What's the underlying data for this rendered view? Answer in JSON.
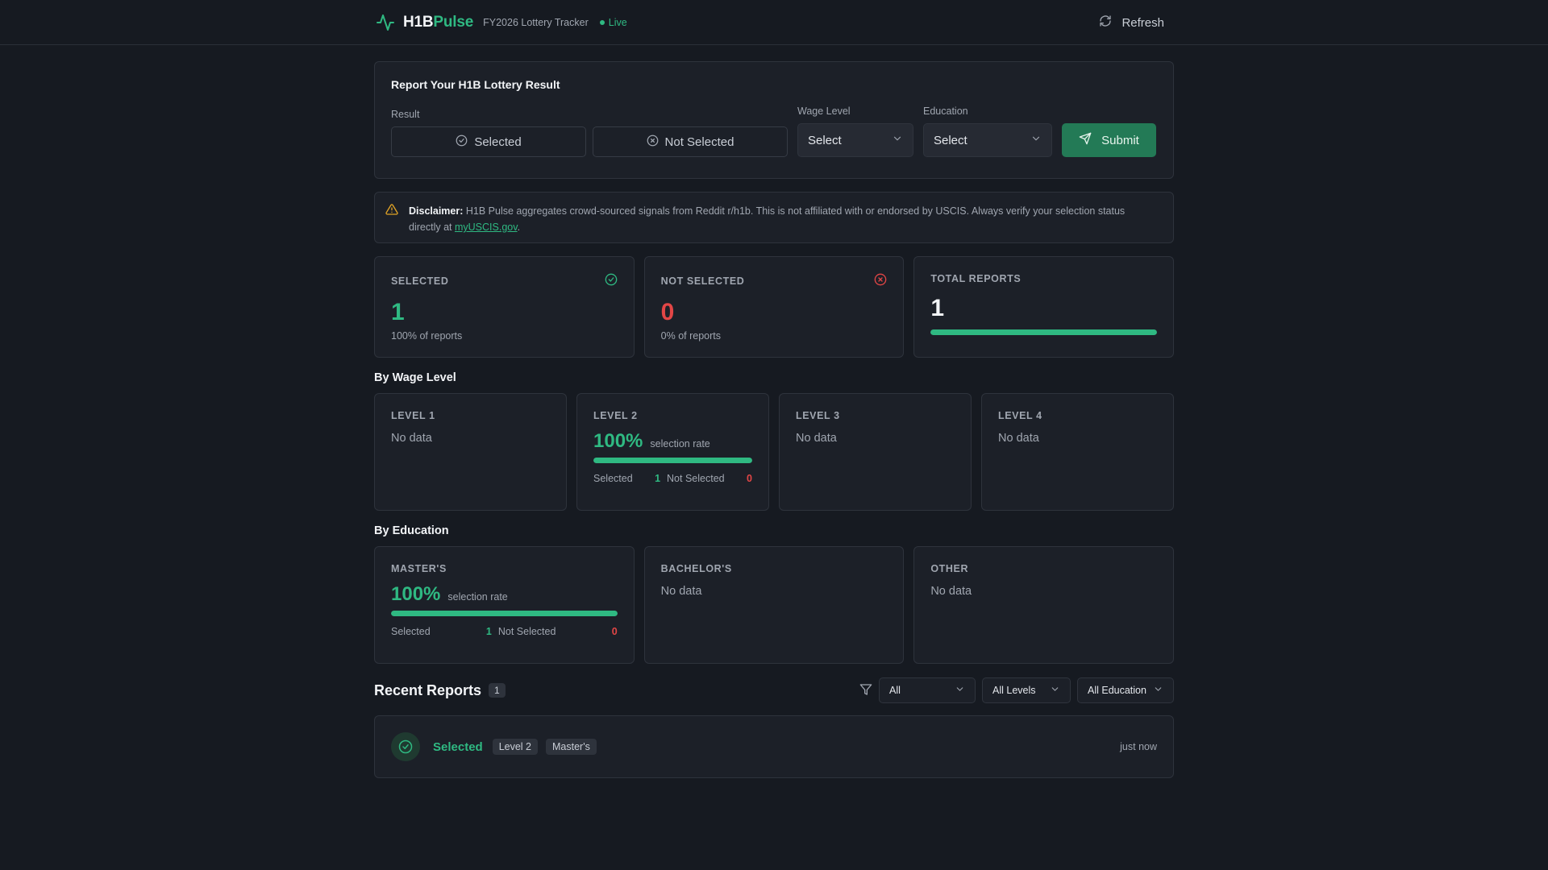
{
  "header": {
    "brand_prefix": "H1B",
    "brand_accent": "Pulse",
    "subtitle": "FY2026 Lottery Tracker",
    "live": "Live",
    "refresh": "Refresh"
  },
  "report_form": {
    "title": "Report Your H1B Lottery Result",
    "result_label": "Result",
    "selected_btn": "Selected",
    "not_selected_btn": "Not Selected",
    "wage_label": "Wage Level",
    "wage_value": "Select",
    "education_label": "Education",
    "education_value": "Select",
    "submit": "Submit"
  },
  "disclaimer": {
    "bold": "Disclaimer:",
    "text": "H1B Pulse aggregates crowd-sourced signals from Reddit r/h1b. This is not affiliated with or endorsed by USCIS. Always verify your selection status directly at",
    "link": "myUSCIS.gov",
    "end": "."
  },
  "stats": {
    "selected": {
      "label": "Selected",
      "value": "1",
      "sub": "100% of reports"
    },
    "not_selected": {
      "label": "Not Selected",
      "value": "0",
      "sub": "0% of reports"
    },
    "total": {
      "label": "Total Reports",
      "value": "1",
      "bar_fraction": 1.0
    }
  },
  "wage_section": {
    "title": "By Wage Level",
    "levels": [
      {
        "label": "Level 1",
        "nodata": "No data"
      },
      {
        "label": "Level 2",
        "rate": "100%",
        "rate_text": "selection rate",
        "rate_fraction": 1.0,
        "selected_label": "Selected",
        "selected": "1",
        "not_selected_label": "Not Selected",
        "not_selected": "0"
      },
      {
        "label": "Level 3",
        "nodata": "No data"
      },
      {
        "label": "Level 4",
        "nodata": "No data"
      }
    ]
  },
  "education_section": {
    "title": "By Education",
    "items": [
      {
        "label": "Master's",
        "rate": "100%",
        "rate_text": "selection rate",
        "rate_fraction": 1.0,
        "selected_label": "Selected",
        "selected": "1",
        "not_selected_label": "Not Selected",
        "not_selected": "0"
      },
      {
        "label": "Bachelor's",
        "nodata": "No data"
      },
      {
        "label": "Other",
        "nodata": "No data"
      }
    ]
  },
  "recent": {
    "title": "Recent Reports",
    "count": "1",
    "filters": {
      "result": "All",
      "level": "All Levels",
      "education": "All Education"
    },
    "rows": [
      {
        "status": "Selected",
        "level": "Level 2",
        "education": "Master's",
        "time": "just now"
      }
    ]
  },
  "colors": {
    "accent": "#2fb982",
    "danger": "#e24646",
    "submit_bg": "#237a56",
    "background": "#161a21",
    "card": "#1c2028"
  }
}
